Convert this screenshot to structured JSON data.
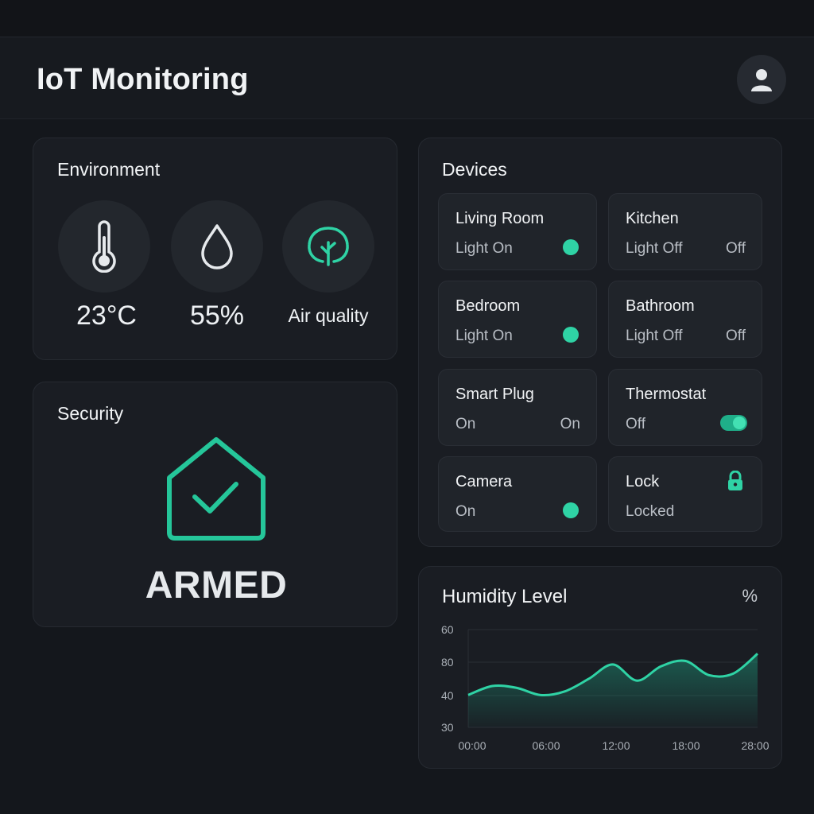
{
  "app": {
    "title": "IoT Monitoring"
  },
  "header": {
    "profile_icon": "user-icon"
  },
  "environment": {
    "title": "Environment",
    "temperature": {
      "icon": "thermometer-icon",
      "value": "23°C"
    },
    "humidity": {
      "icon": "droplet-icon",
      "value": "55%"
    },
    "air": {
      "icon": "tree-icon",
      "label": "Air quality",
      "color": "#2fd3a5"
    }
  },
  "security": {
    "title": "Security",
    "icon": "house-check-icon",
    "status": "ARMED",
    "color": "#25c69a"
  },
  "devices": {
    "title": "Devices",
    "items": [
      {
        "name": "Living Room",
        "status": "Light On",
        "indicator": "dot"
      },
      {
        "name": "Kitchen",
        "status": "Light Off",
        "right": "Off"
      },
      {
        "name": "Bedroom",
        "status": "Light On",
        "indicator": "dot"
      },
      {
        "name": "Bathroom",
        "status": "Light Off",
        "right": "Off"
      },
      {
        "name": "Smart Plug",
        "status": "On",
        "right": "On"
      },
      {
        "name": "Thermostat",
        "status": "Off",
        "indicator": "toggle",
        "toggle_on": true
      },
      {
        "name": "Camera",
        "status": "On",
        "indicator": "dot"
      },
      {
        "name": "Lock",
        "status": "Locked",
        "indicator": "lock-icon"
      }
    ],
    "accent": "#2fd3a5"
  },
  "humidity_chart": {
    "title": "Humidity Level",
    "unit": "%"
  },
  "chart_data": {
    "type": "area",
    "title": "Humidity Level",
    "ylabel": "%",
    "y_ticks": [
      "60",
      "80",
      "40",
      "30"
    ],
    "x_ticks": [
      "00:00",
      "06:00",
      "12:00",
      "18:00",
      "28:00"
    ],
    "x": [
      "00:00",
      "02:00",
      "04:00",
      "06:00",
      "08:00",
      "10:00",
      "12:00",
      "14:00",
      "16:00",
      "18:00",
      "20:00",
      "22:00",
      "24:00"
    ],
    "values": [
      48,
      53,
      52,
      48,
      50,
      57,
      65,
      56,
      64,
      67,
      59,
      60,
      71
    ],
    "line_color": "#2fd3a5",
    "grid": true
  }
}
